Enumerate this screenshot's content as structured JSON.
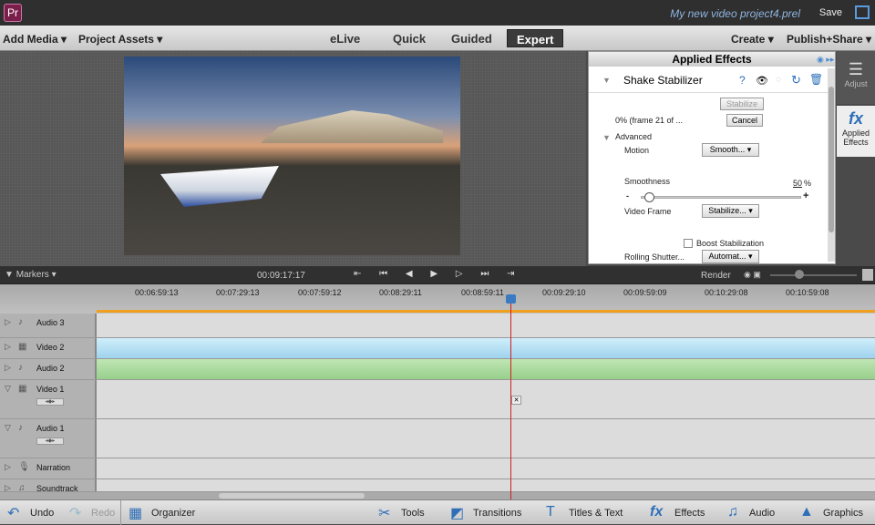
{
  "app": {
    "title": "My new video project4.prel",
    "save_label": "Save",
    "logo": "Pr"
  },
  "menu": {
    "add_media": "Add Media ▾",
    "project_assets": "Project Assets ▾",
    "modes": [
      "eLive",
      "Quick",
      "Guided",
      "Expert"
    ],
    "selected_mode": "Expert",
    "create": "Create ▾",
    "publish": "Publish+Share ▾"
  },
  "effects": {
    "header": "Applied Effects",
    "effect_name": "Shake Stabilizer",
    "stabilize": "Stabilize",
    "progress": "0% (frame 21 of ...",
    "cancel": "Cancel",
    "advanced": "Advanced",
    "motion_label": "Motion",
    "motion_value": "Smooth... ▾",
    "smoothness_label": "Smoothness",
    "smoothness_value": "50",
    "smoothness_unit": "%",
    "smoothness_percent": 50,
    "minus": "-",
    "plus": "+",
    "video_frame_label": "Video Frame",
    "video_frame_value": "Stabilize... ▾",
    "boost_label": "Boost Stabilization",
    "boost_checked": false,
    "rolling_label": "Rolling Shutter...",
    "rolling_value": "Automat... ▾"
  },
  "rightbar": {
    "adjust": "Adjust",
    "applied_effects": "Applied Effects",
    "fx": "fx"
  },
  "timeline": {
    "markers": "Markers ▾",
    "current_time": "00:09:17:17",
    "render": "Render",
    "ticks": [
      "00:06:59:13",
      "00:07:29:13",
      "00:07:59:12",
      "00:08:29:11",
      "00:08:59:11",
      "00:09:29:10",
      "00:09:59:09",
      "00:10:29:08",
      "00:10:59:08"
    ],
    "tracks": [
      {
        "name": "Audio 3",
        "icon": "♪"
      },
      {
        "name": "Video 2",
        "icon": "▦"
      },
      {
        "name": "Audio 2",
        "icon": "♪"
      },
      {
        "name": "Video 1",
        "icon": "▦"
      },
      {
        "name": "Audio 1",
        "icon": "♪"
      },
      {
        "name": "Narration",
        "icon": "🎙"
      },
      {
        "name": "Soundtrack",
        "icon": "♫"
      }
    ]
  },
  "bottom": {
    "undo": "Undo",
    "redo": "Redo",
    "organizer": "Organizer",
    "tools": "Tools",
    "transitions": "Transitions",
    "titles": "Titles & Text",
    "effects": "Effects",
    "audio": "Audio",
    "graphics": "Graphics"
  },
  "colors": {
    "accent": "#2e6fb8",
    "playhead": "#d02020",
    "video_clip": "#a8d8f0",
    "audio_clip": "#a6d79a"
  }
}
